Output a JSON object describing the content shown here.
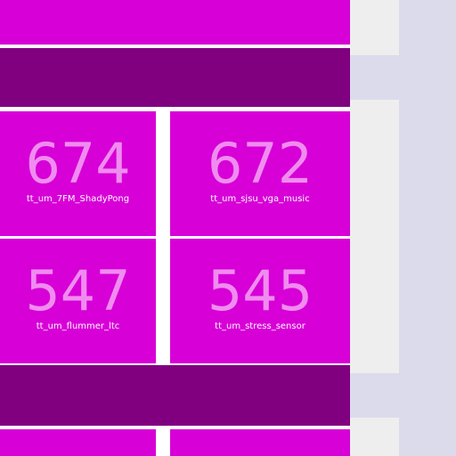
{
  "colors": {
    "tile_magenta": "#d700d7",
    "band_purple": "#800080",
    "side_light": "#eeeeee",
    "side_lavender": "#dcdbec",
    "number_text": "#f08cf0",
    "label_text": "#ffffff"
  },
  "tiles": [
    {
      "value": "674",
      "label": "tt_um_7FM_ShadyPong"
    },
    {
      "value": "672",
      "label": "tt_um_sjsu_vga_music"
    },
    {
      "value": "547",
      "label": "tt_um_flummer_ltc"
    },
    {
      "value": "545",
      "label": "tt_um_stress_sensor"
    }
  ]
}
